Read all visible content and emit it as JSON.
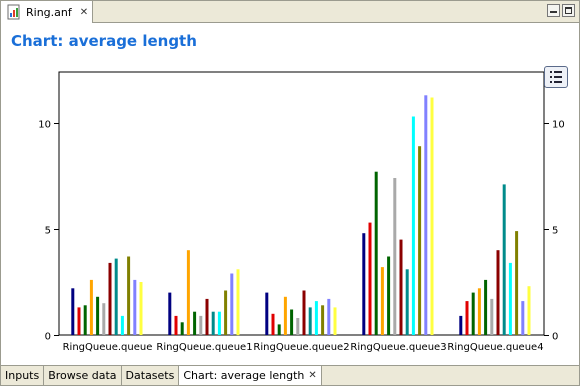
{
  "editor": {
    "tab_label": "Ring.anf",
    "tab_close": "✕",
    "page_title": "Chart: average length"
  },
  "bottom_tabs": [
    {
      "label": "Inputs"
    },
    {
      "label": "Browse data"
    },
    {
      "label": "Datasets"
    },
    {
      "label": "Chart: average length"
    }
  ],
  "chart_data": {
    "type": "bar",
    "title": "Chart: average length",
    "xlabel": "",
    "ylabel": "",
    "ylim": [
      0,
      12.4
    ],
    "yticks": [
      0,
      5,
      10
    ],
    "grid": false,
    "categories": [
      "RingQueue.queue",
      "RingQueue.queue1",
      "RingQueue.queue2",
      "RingQueue.queue3",
      "RingQueue.queue4"
    ],
    "series_colors": [
      "#000080",
      "#e00000",
      "#006400",
      "#ffa500",
      "#006400",
      "#a9a9a9",
      "#8b0000",
      "#008b8b",
      "#00ffff",
      "#808000",
      "#8080ff",
      "#ffff40"
    ],
    "groups": [
      [
        2.2,
        1.3,
        1.4,
        2.6,
        1.8,
        1.5,
        3.4,
        3.6,
        0.9,
        3.7,
        2.6,
        2.5
      ],
      [
        2.0,
        0.9,
        0.6,
        4.0,
        1.1,
        0.9,
        1.7,
        1.1,
        1.1,
        2.1,
        2.9,
        3.1
      ],
      [
        2.0,
        1.0,
        0.5,
        1.8,
        1.2,
        0.8,
        2.1,
        1.3,
        1.6,
        1.4,
        1.7,
        1.3
      ],
      [
        4.8,
        5.3,
        7.7,
        3.2,
        3.7,
        7.4,
        4.5,
        3.1,
        10.3,
        8.9,
        11.3,
        11.2
      ],
      [
        0.9,
        1.6,
        2.0,
        2.2,
        2.6,
        1.7,
        4.0,
        7.1,
        3.4,
        4.9,
        1.6,
        2.3
      ]
    ]
  }
}
